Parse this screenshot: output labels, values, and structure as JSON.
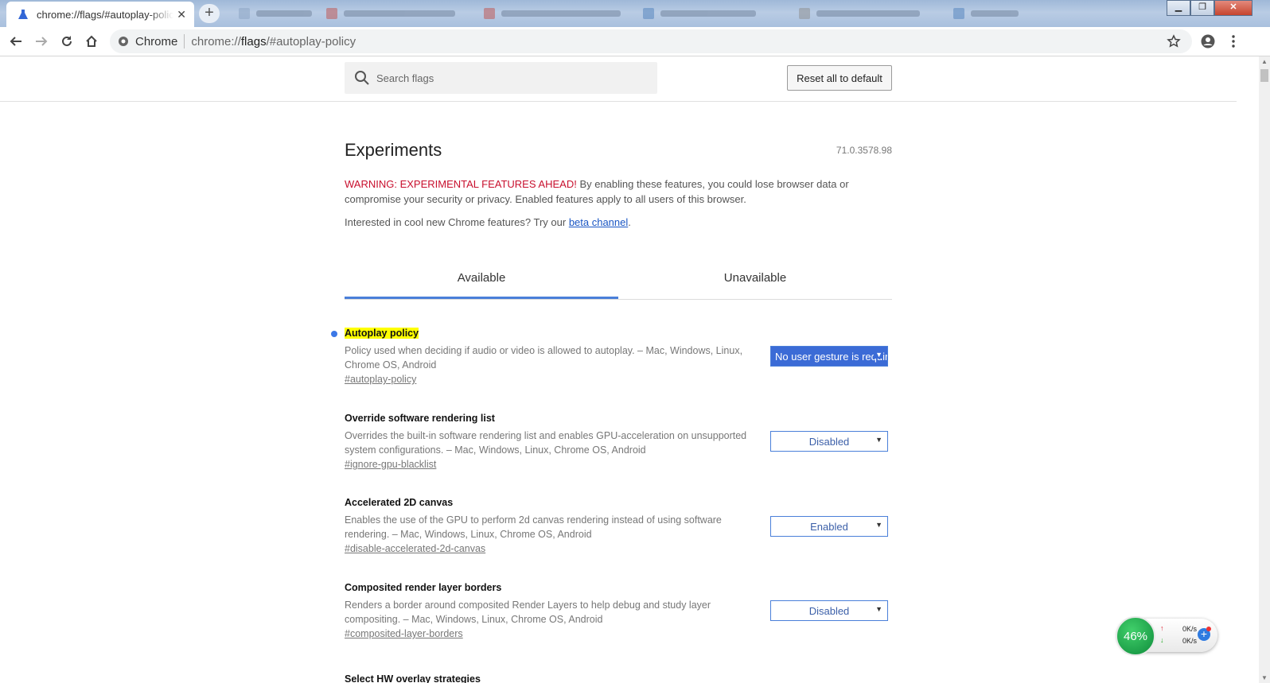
{
  "browser": {
    "tab_title": "chrome://flags/#autoplay-policy",
    "new_tab_symbol": "+",
    "close_symbol": "✕",
    "omnibox_chip": "Chrome",
    "url_scheme": "chrome://",
    "url_host": "flags",
    "url_path": "/#autoplay-policy",
    "window_controls": {
      "minimize": "▁",
      "maximize": "❐",
      "close": "✕"
    }
  },
  "header": {
    "search_placeholder": "Search flags",
    "reset_label": "Reset all to default"
  },
  "page": {
    "title": "Experiments",
    "version": "71.0.3578.98",
    "warning_red": "WARNING: EXPERIMENTAL FEATURES AHEAD!",
    "warning_text": " By enabling these features, you could lose browser data or compromise your security or privacy. Enabled features apply to all users of this browser.",
    "interest_text": "Interested in cool new Chrome features? Try our ",
    "beta_link": "beta channel",
    "interest_end": ".",
    "tabs": [
      {
        "label": "Available",
        "active": true
      },
      {
        "label": "Unavailable",
        "active": false
      }
    ]
  },
  "experiments": [
    {
      "name": "Autoplay policy",
      "description": "Policy used when deciding if audio or video is allowed to autoplay. – Mac, Windows, Linux, Chrome OS, Android",
      "link": "#autoplay-policy",
      "value": "No user gesture is required",
      "highlighted": true
    },
    {
      "name": "Override software rendering list",
      "description": "Overrides the built-in software rendering list and enables GPU-acceleration on unsupported system configurations. – Mac, Windows, Linux, Chrome OS, Android",
      "link": "#ignore-gpu-blacklist",
      "value": "Disabled",
      "highlighted": false
    },
    {
      "name": "Accelerated 2D canvas",
      "description": "Enables the use of the GPU to perform 2d canvas rendering instead of using software rendering. – Mac, Windows, Linux, Chrome OS, Android",
      "link": "#disable-accelerated-2d-canvas",
      "value": "Enabled",
      "highlighted": false
    },
    {
      "name": "Composited render layer borders",
      "description": "Renders a border around composited Render Layers to help debug and study layer compositing. – Mac, Windows, Linux, Chrome OS, Android",
      "link": "#composited-layer-borders",
      "value": "Disabled",
      "highlighted": false
    },
    {
      "name": "Select HW overlay strategies",
      "description": "",
      "link": "",
      "value": "",
      "highlighted": false
    }
  ],
  "net_widget": {
    "percent": "46%",
    "upload": "0K/s",
    "download": "0K/s",
    "up_arrow": "↑",
    "down_arrow": "↓",
    "plus": "+"
  },
  "colors": {
    "accent_blue": "#4a7fd9",
    "warning_red": "#c8102e",
    "highlight_yellow": "#ffff00",
    "link_blue": "#1a56c4"
  }
}
